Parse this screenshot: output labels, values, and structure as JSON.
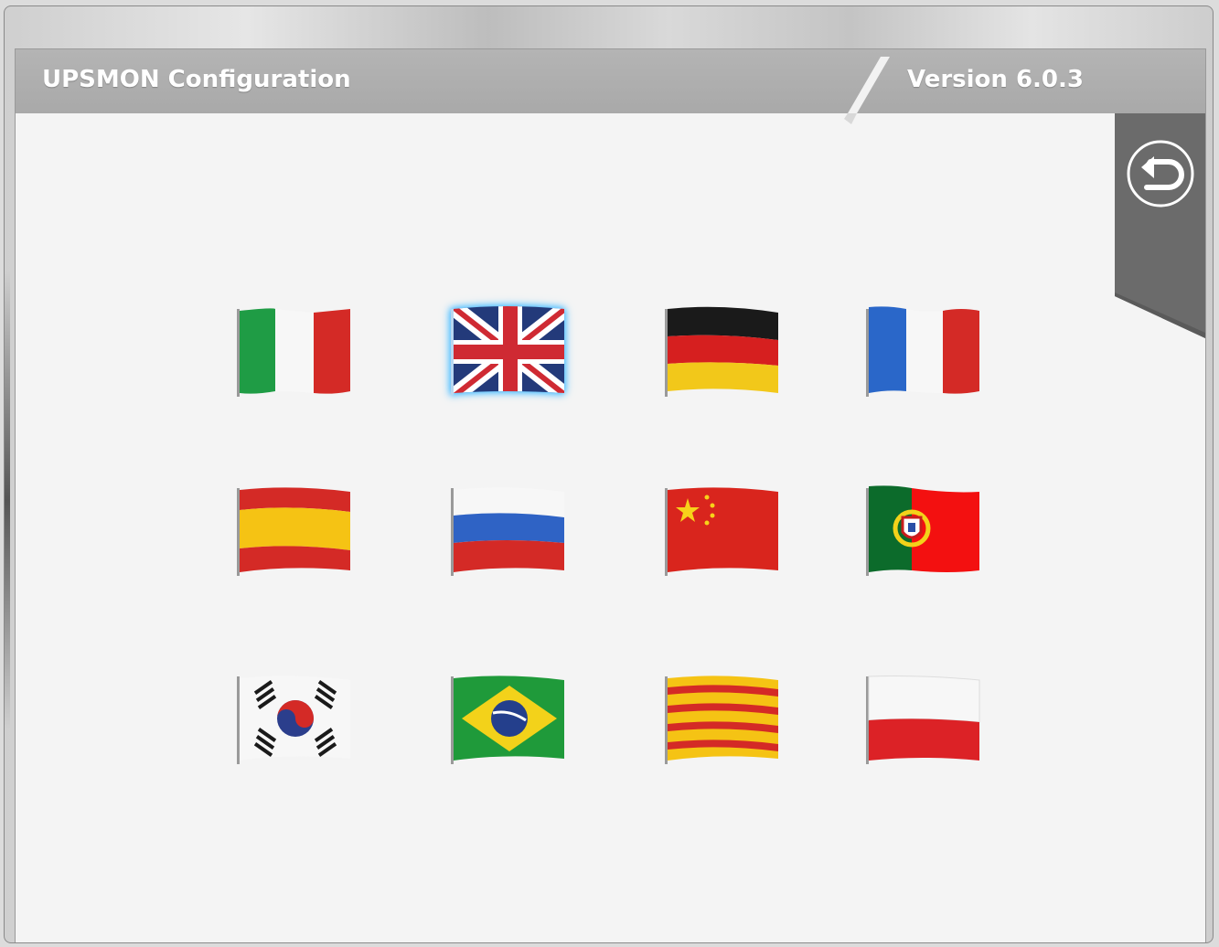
{
  "window": {
    "title": "UPSMON Configuration",
    "version": "Version 6.0.3"
  },
  "toolbar": {
    "back_icon": "undo-arrow-icon"
  },
  "languages": {
    "selected": "flag-uk",
    "flags": [
      {
        "id": "flag-italy"
      },
      {
        "id": "flag-uk"
      },
      {
        "id": "flag-germany"
      },
      {
        "id": "flag-france"
      },
      {
        "id": "flag-spain"
      },
      {
        "id": "flag-russia"
      },
      {
        "id": "flag-china"
      },
      {
        "id": "flag-portugal"
      },
      {
        "id": "flag-south-korea"
      },
      {
        "id": "flag-brazil"
      },
      {
        "id": "flag-catalonia"
      },
      {
        "id": "flag-poland"
      }
    ]
  },
  "colors": {
    "header": "#aaaaaa",
    "panel": "#f4f4f4",
    "back_tab": "#6b6b6b",
    "selection_glow": "#3fb6ff"
  }
}
